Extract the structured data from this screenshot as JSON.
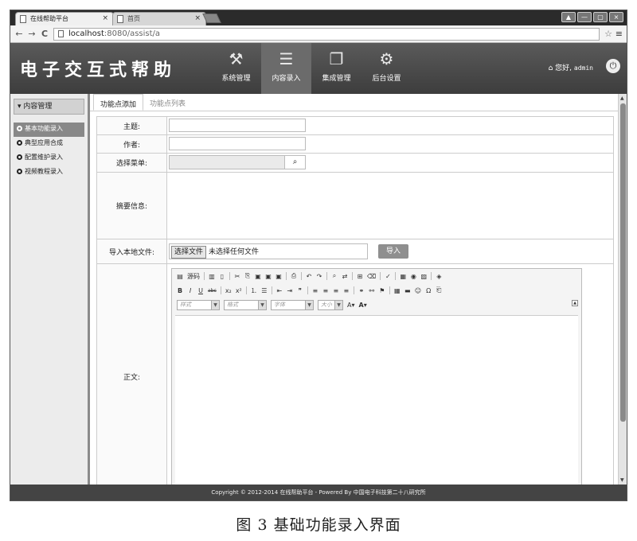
{
  "browser": {
    "tabs": [
      {
        "title": "在线帮助平台",
        "close": "×"
      },
      {
        "title": "首页",
        "close": "×"
      }
    ],
    "nav": {
      "back": "←",
      "forward": "→",
      "reload": "C"
    },
    "url_host": "localhost",
    "url_path": ":8080/assist/a",
    "star": "☆",
    "menu": "≡",
    "window_buttons": [
      "▲",
      "—",
      "▢",
      "×"
    ]
  },
  "header": {
    "logo": "电子交互式帮助",
    "nav": [
      {
        "label": "系统管理",
        "icon": "tools-icon",
        "glyph": "⚒"
      },
      {
        "label": "内容录入",
        "icon": "document-icon",
        "glyph": "☰"
      },
      {
        "label": "集成管理",
        "icon": "folder-icon",
        "glyph": "❐"
      },
      {
        "label": "后台设置",
        "icon": "monitor-icon",
        "glyph": "⚙"
      }
    ],
    "active_nav": 1,
    "greeting": "您好,",
    "username": "admin",
    "home_glyph": "⌂",
    "power_glyph": "⏻"
  },
  "sidebar": {
    "title": "内容管理",
    "items": [
      {
        "label": "基本功能录入"
      },
      {
        "label": "典型应用合成"
      },
      {
        "label": "配置维护录入"
      },
      {
        "label": "视频教程录入"
      }
    ]
  },
  "subtabs": [
    {
      "label": "功能点添加"
    },
    {
      "label": "功能点列表"
    }
  ],
  "form": {
    "subject_label": "主题:",
    "author_label": "作者:",
    "menu_label": "选择菜单:",
    "summary_label": "摘要信息:",
    "import_label": "导入本地文件:",
    "file_button": "选择文件",
    "file_status": "未选择任何文件",
    "import_button": "导入",
    "body_label": "正文:"
  },
  "editor": {
    "source_label": "源码",
    "format_combos": [
      "样式",
      "格式",
      "字体",
      "大小"
    ]
  },
  "footer": "Copyright © 2012-2014 在线帮助平台 - Powered By 中国电子科技第二十八研究所",
  "caption": "图 3   基础功能录入界面",
  "colors": {
    "header_bg": "#4a4a4a",
    "footer_bg": "#444444",
    "active_side": "#888888"
  }
}
